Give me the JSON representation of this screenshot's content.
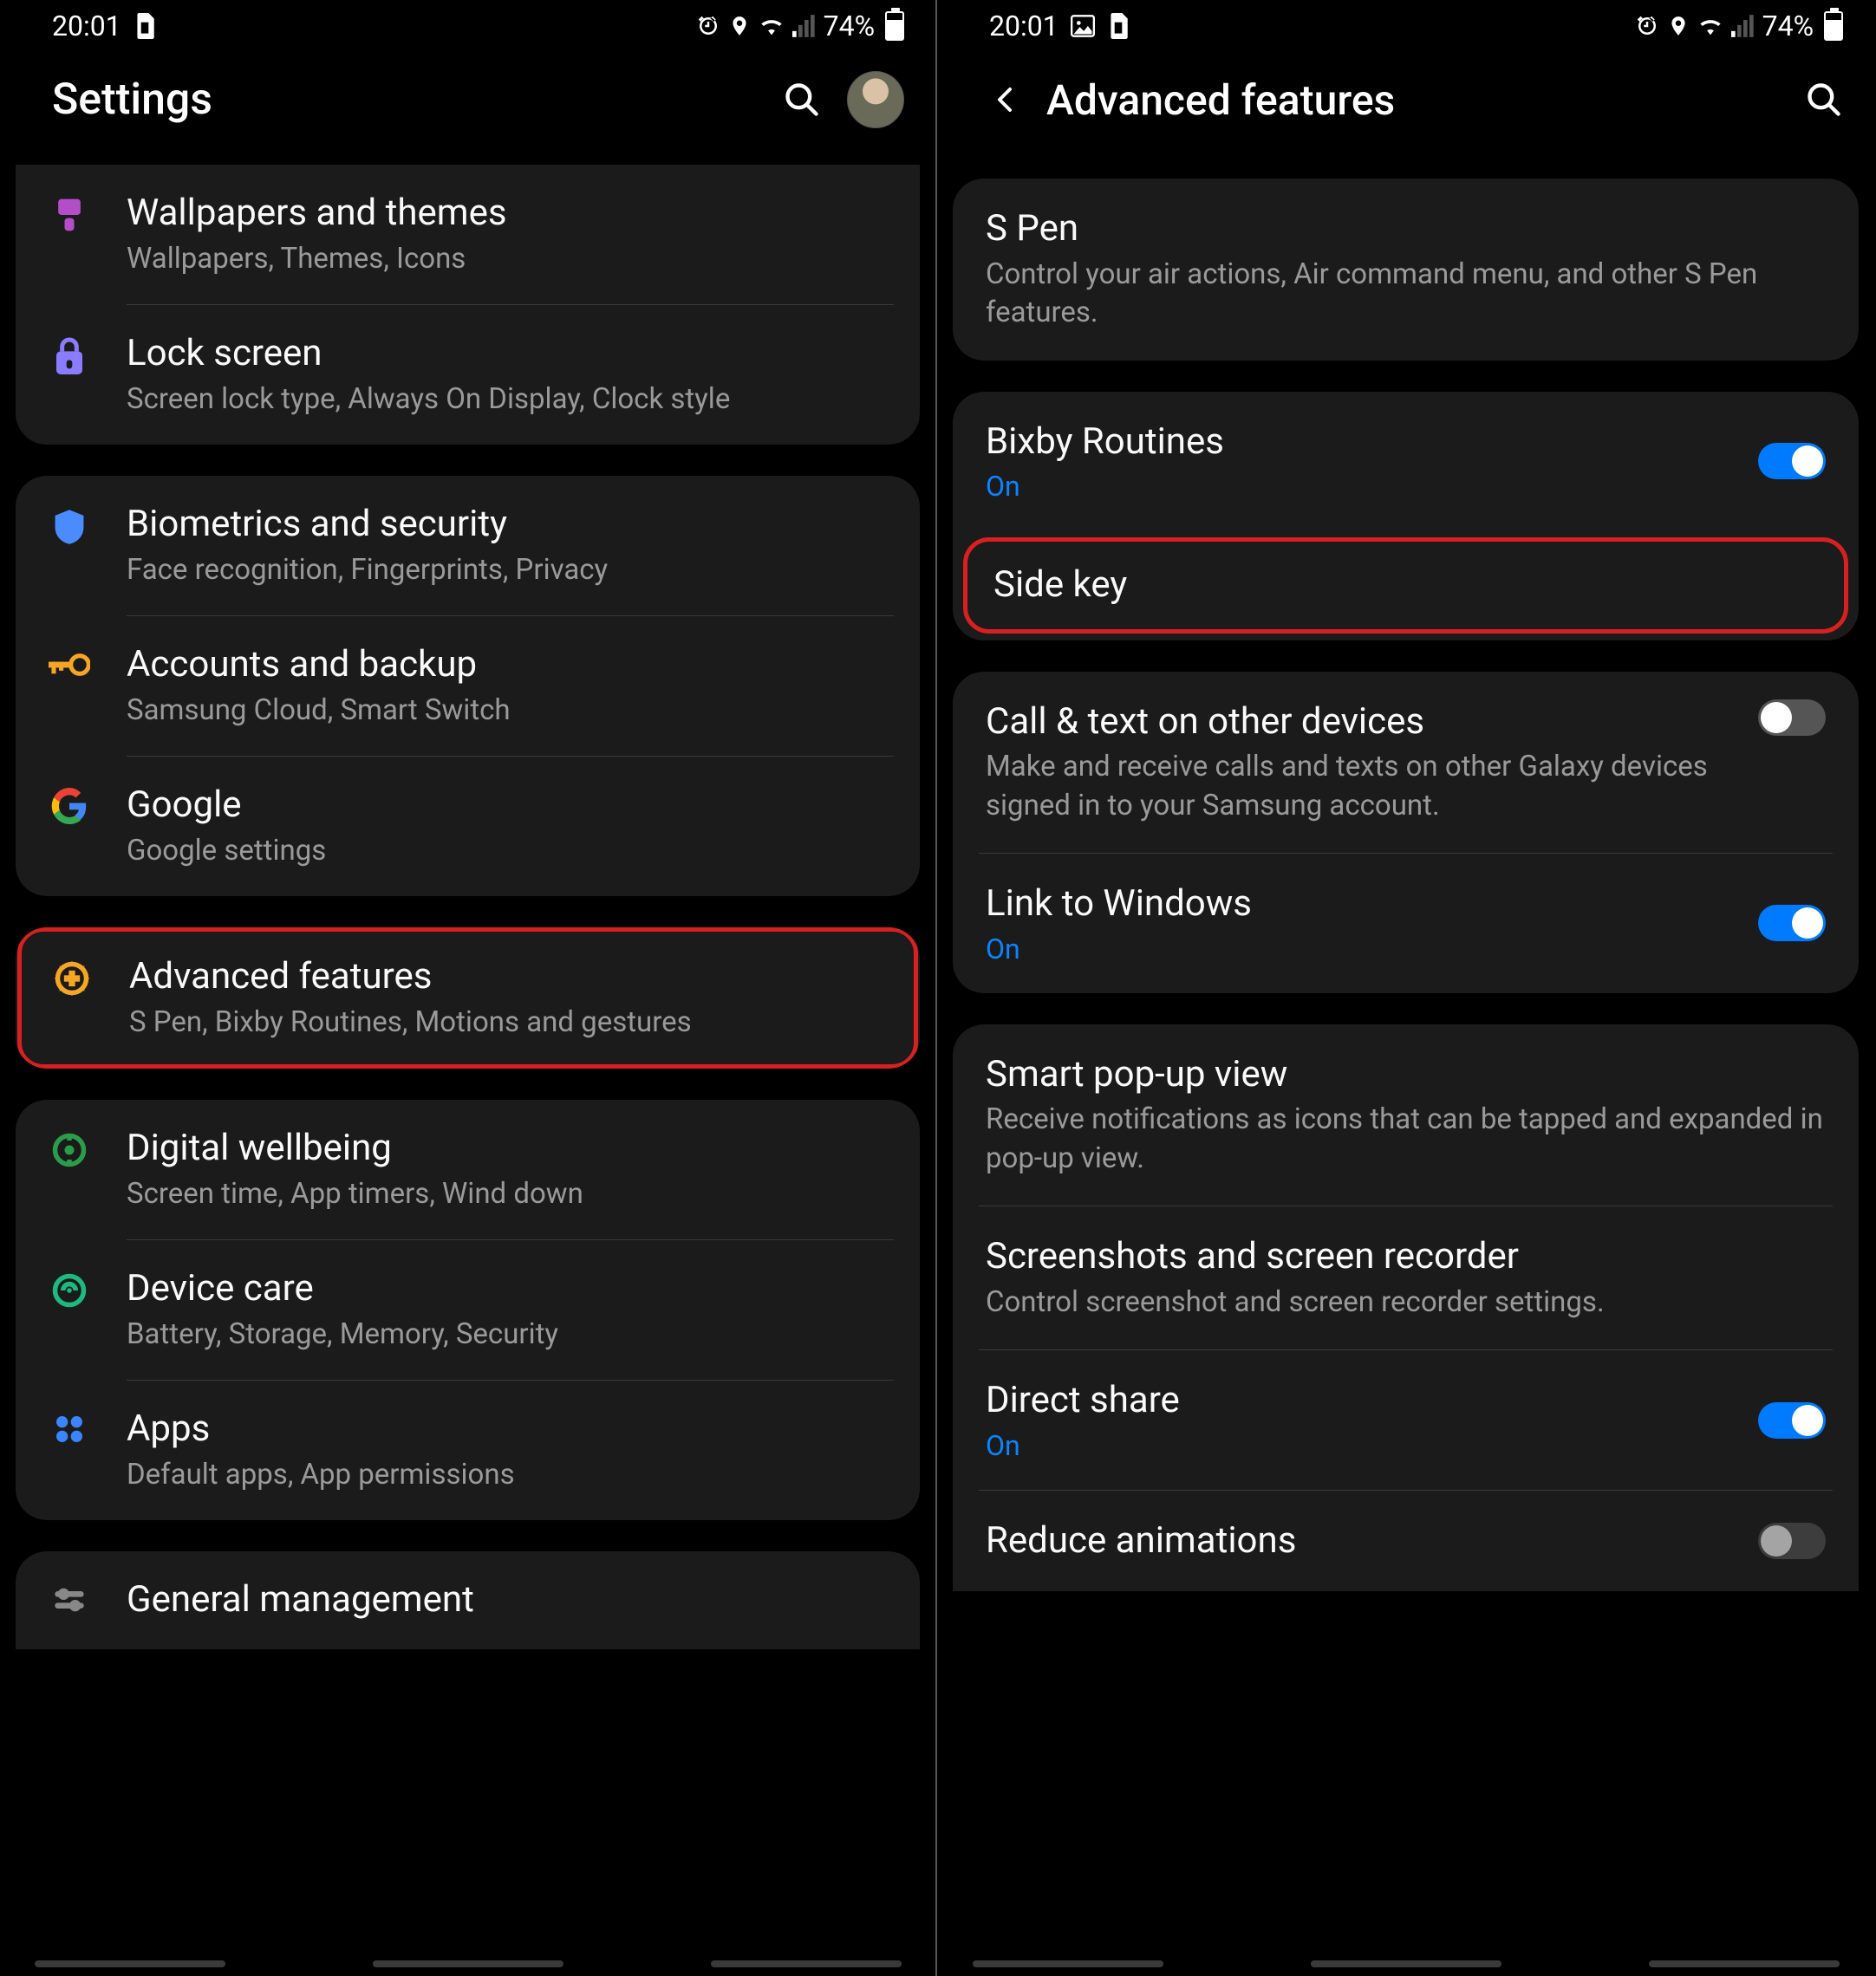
{
  "status": {
    "time": "20:01",
    "battery": "74%"
  },
  "left": {
    "title": "Settings",
    "items": [
      {
        "title": "Wallpapers and themes",
        "sub": "Wallpapers, Themes, Icons"
      },
      {
        "title": "Lock screen",
        "sub": "Screen lock type, Always On Display, Clock style"
      },
      {
        "title": "Biometrics and security",
        "sub": "Face recognition, Fingerprints, Privacy"
      },
      {
        "title": "Accounts and backup",
        "sub": "Samsung Cloud, Smart Switch"
      },
      {
        "title": "Google",
        "sub": "Google settings"
      },
      {
        "title": "Advanced features",
        "sub": "S Pen, Bixby Routines, Motions and gestures"
      },
      {
        "title": "Digital wellbeing",
        "sub": "Screen time, App timers, Wind down"
      },
      {
        "title": "Device care",
        "sub": "Battery, Storage, Memory, Security"
      },
      {
        "title": "Apps",
        "sub": "Default apps, App permissions"
      },
      {
        "title": "General management",
        "sub": ""
      }
    ]
  },
  "right": {
    "title": "Advanced features",
    "items": [
      {
        "title": "S Pen",
        "sub": "Control your air actions, Air command menu, and other S Pen features."
      },
      {
        "title": "Bixby Routines",
        "status": "On",
        "toggle": "on"
      },
      {
        "title": "Side key"
      },
      {
        "title": "Call & text on other devices",
        "sub": "Make and receive calls and texts on other Galaxy devices signed in to your Samsung account.",
        "toggle": "off"
      },
      {
        "title": "Link to Windows",
        "status": "On",
        "toggle": "on"
      },
      {
        "title": "Smart pop-up view",
        "sub": "Receive notifications as icons that can be tapped and expanded in pop-up view."
      },
      {
        "title": "Screenshots and screen recorder",
        "sub": "Control screenshot and screen recorder settings."
      },
      {
        "title": "Direct share",
        "status": "On",
        "toggle": "on"
      },
      {
        "title": "Reduce animations"
      }
    ]
  }
}
